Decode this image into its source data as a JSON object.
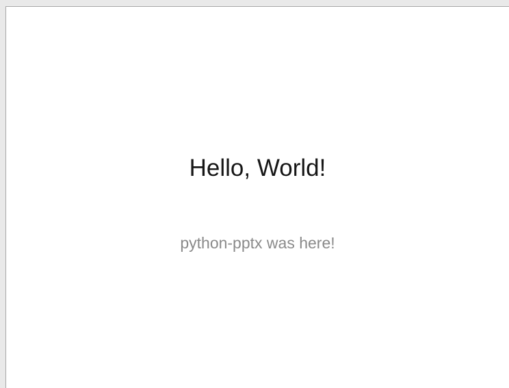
{
  "slide": {
    "title": "Hello, World!",
    "subtitle": "python-pptx was here!"
  },
  "colors": {
    "title": "#161616",
    "subtitle": "#8a8a8a",
    "slide_background": "#ffffff"
  }
}
